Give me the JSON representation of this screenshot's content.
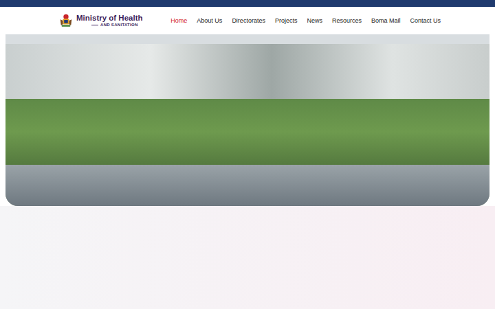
{
  "logo": {
    "title": "Ministry of Health",
    "subtitle": "AND SANITATION"
  },
  "nav": [
    {
      "label": "Home",
      "selected": true
    },
    {
      "label": "About Us",
      "selected": false
    },
    {
      "label": "Directorates",
      "selected": false
    },
    {
      "label": "Projects",
      "selected": false
    },
    {
      "label": "News",
      "selected": false
    },
    {
      "label": "Resources",
      "selected": false
    },
    {
      "label": "Boma Mail",
      "selected": false
    },
    {
      "label": "Contact Us",
      "selected": false
    }
  ]
}
